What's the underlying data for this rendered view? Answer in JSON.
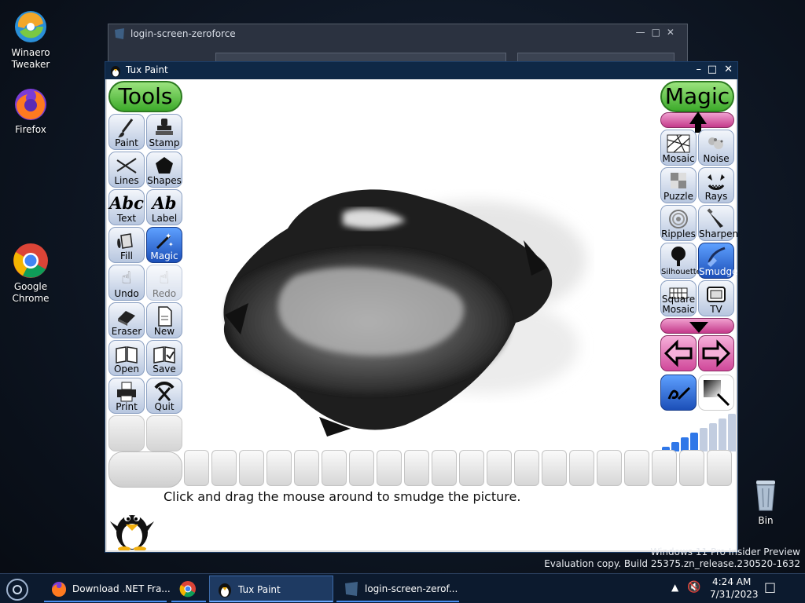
{
  "desktop": {
    "icons": [
      {
        "label_line1": "Winaero",
        "label_line2": "Tweaker"
      },
      {
        "label_line1": "Firefox",
        "label_line2": ""
      },
      {
        "label_line1": "Google",
        "label_line2": "Chrome"
      },
      {
        "label_line1": "Bin",
        "label_line2": ""
      }
    ]
  },
  "background_window": {
    "title": "login-screen-zeroforce"
  },
  "tuxpaint": {
    "window_title": "Tux Paint",
    "tools_header": "Tools",
    "magic_header": "Magic",
    "tools": [
      {
        "label": "Paint"
      },
      {
        "label": "Stamp"
      },
      {
        "label": "Lines"
      },
      {
        "label": "Shapes"
      },
      {
        "label": "Text",
        "glyph": "Abc"
      },
      {
        "label": "Label",
        "glyph": "Ab"
      },
      {
        "label": "Fill"
      },
      {
        "label": "Magic"
      },
      {
        "label": "Undo"
      },
      {
        "label": "Redo"
      },
      {
        "label": "Eraser"
      },
      {
        "label": "New"
      },
      {
        "label": "Open"
      },
      {
        "label": "Save"
      },
      {
        "label": "Print"
      },
      {
        "label": "Quit"
      }
    ],
    "active_tool": "Magic",
    "magic_tools": [
      {
        "label": "Mosaic"
      },
      {
        "label": "Noise"
      },
      {
        "label": "Puzzle"
      },
      {
        "label": "Rays"
      },
      {
        "label": "Ripples"
      },
      {
        "label": "Sharpen"
      },
      {
        "label": "Silhouette"
      },
      {
        "label": "Smudge"
      },
      {
        "label_line1": "Square",
        "label_line2": "Mosaic"
      },
      {
        "label": "TV"
      }
    ],
    "active_magic": "Smudge",
    "instruction": "Click and drag the mouse around to smudge the picture.",
    "brush_size_level": 0.6
  },
  "watermark": {
    "line1": "Windows 11 Pro Insider Preview",
    "line2": "Evaluation copy. Build 25375.zn_release.230520-1632"
  },
  "taskbar": {
    "items": [
      {
        "label": "Download .NET Fra..."
      },
      {
        "label": ""
      },
      {
        "label": "Tux Paint"
      },
      {
        "label": "login-screen-zerof..."
      }
    ],
    "time": "4:24 AM",
    "date": "7/31/2023"
  },
  "colors": {
    "accent": "#2f77e8",
    "tools_green": "#3caa2a",
    "scroll_pink": "#c43a8a"
  }
}
